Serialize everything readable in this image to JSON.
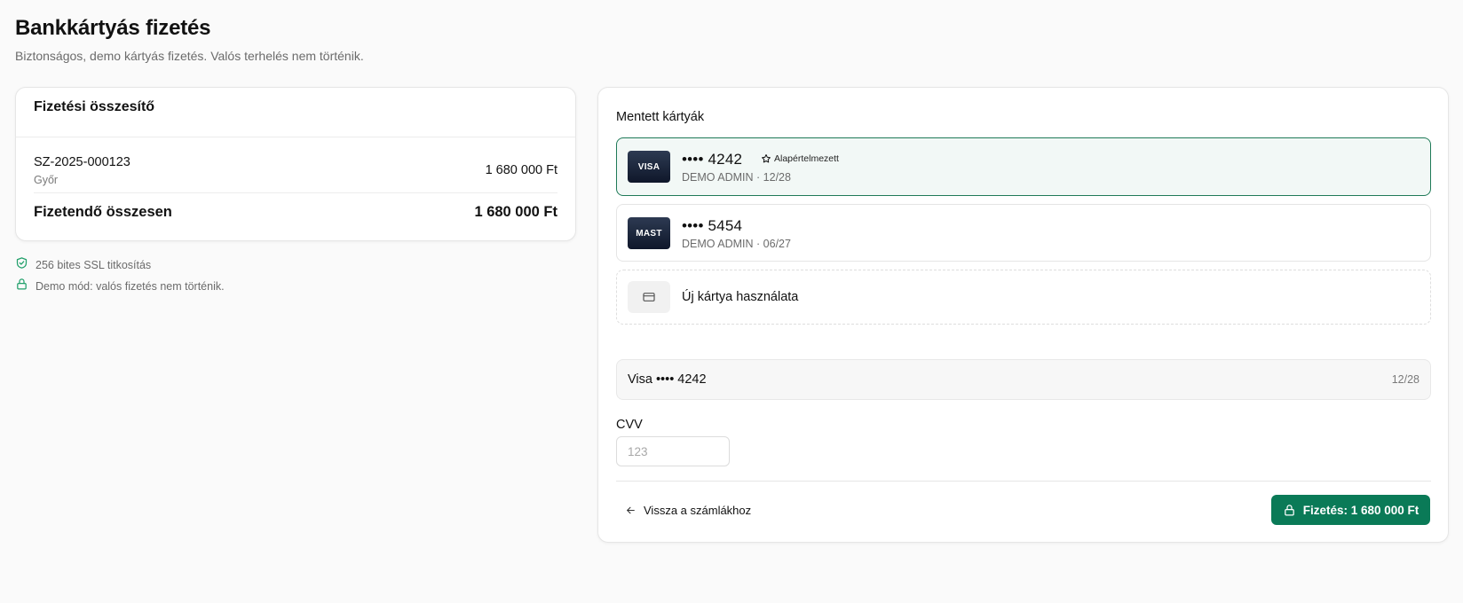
{
  "page": {
    "title": "Bankkártyás fizetés",
    "subtitle": "Biztonságos, demo kártyás fizetés. Valós terhelés nem történik."
  },
  "summary": {
    "title": "Fizetési összesítő",
    "invoice": {
      "id": "SZ-2025-000123",
      "city": "Győr",
      "amount": "1 680 000 Ft"
    },
    "total_label": "Fizetendő összesen",
    "total_amount": "1 680 000 Ft"
  },
  "notes": [
    {
      "icon": "shield-check-icon",
      "text": "256 bites SSL titkosítás"
    },
    {
      "icon": "lock-icon",
      "text": "Demo mód: valós fizetés nem történik."
    }
  ],
  "payment": {
    "saved_cards_label": "Mentett kártyák",
    "cards": [
      {
        "brand": "VISA",
        "number": "•••• 4242",
        "holder": "DEMO ADMIN · 12/28",
        "badge": "Alapértelmezett",
        "selected": true
      },
      {
        "brand": "MAST",
        "number": "•••• 5454",
        "holder": "DEMO ADMIN · 06/27",
        "selected": false
      }
    ],
    "new_card_label": "Új kártya használata",
    "selected_card": {
      "label": "Visa •••• 4242",
      "expiry": "12/28"
    },
    "cvv": {
      "label": "CVV",
      "placeholder": "123",
      "value": ""
    },
    "back_label": "Vissza a számlákhoz",
    "pay_label": "Fizetés: 1 680 000 Ft"
  },
  "colors": {
    "accent": "#0a7a57",
    "selected_border": "#1f7a58",
    "selected_bg": "#f2f8f6",
    "note_icon": "#22a06b",
    "card_chip": "#1e293b"
  }
}
